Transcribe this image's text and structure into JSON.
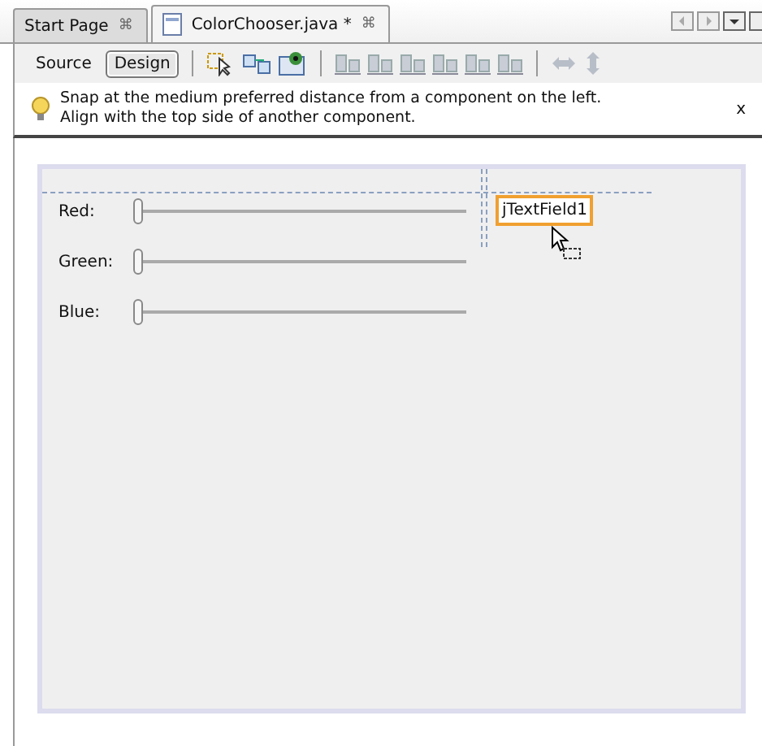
{
  "tabs": [
    {
      "label": "Start Page",
      "close": "⌘",
      "selected": false,
      "kind": "plain"
    },
    {
      "label": "ColorChooser.java *",
      "close": "⌘",
      "selected": true,
      "kind": "file"
    }
  ],
  "toolbar": {
    "views": [
      {
        "label": "Source",
        "selected": false
      },
      {
        "label": "Design",
        "selected": true
      }
    ]
  },
  "hint": {
    "lines": [
      "Snap at the medium preferred distance from a component on the left.",
      "Align with the top side of another component."
    ],
    "close": "x"
  },
  "form": {
    "sliders": [
      {
        "label": "Red:",
        "level": 0
      },
      {
        "label": "Green:",
        "level": 0
      },
      {
        "label": "Blue:",
        "level": 0
      }
    ],
    "text_field": {
      "value": "jTextField1",
      "selected": true
    }
  }
}
